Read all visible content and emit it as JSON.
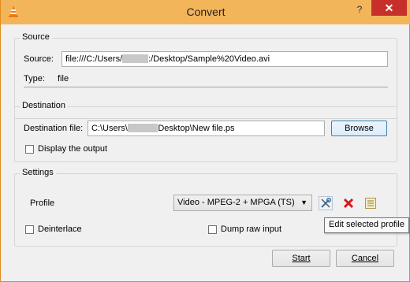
{
  "window": {
    "title": "Convert",
    "help_label": "?",
    "close_label": "✕"
  },
  "source": {
    "group_label": "Source",
    "source_label": "Source:",
    "source_value_prefix": "file:///C:/Users/",
    "source_value_redacted": "xxxxxx",
    "source_value_suffix": ":/Desktop/Sample%20Video.avi",
    "type_label": "Type:",
    "type_value": "file"
  },
  "destination": {
    "group_label": "Destination",
    "file_label": "Destination file:",
    "file_value_prefix": "C:\\Users\\",
    "file_value_redacted": "xxxxxxx",
    "file_value_suffix": "Desktop\\New file.ps",
    "browse_label": "Browse",
    "display_output_label": "Display the output"
  },
  "settings": {
    "group_label": "Settings",
    "profile_label": "Profile",
    "profile_selected": "Video - MPEG-2 + MPGA (TS)",
    "deinterlace_label": "Deinterlace",
    "dump_raw_label": "Dump raw input",
    "tooltip": "Edit selected profile"
  },
  "footer": {
    "start_label": "Start",
    "cancel_label": "Cancel"
  },
  "colors": {
    "titlebar": "#f3b55a",
    "close": "#c7302a",
    "delete": "#d21a1a"
  }
}
